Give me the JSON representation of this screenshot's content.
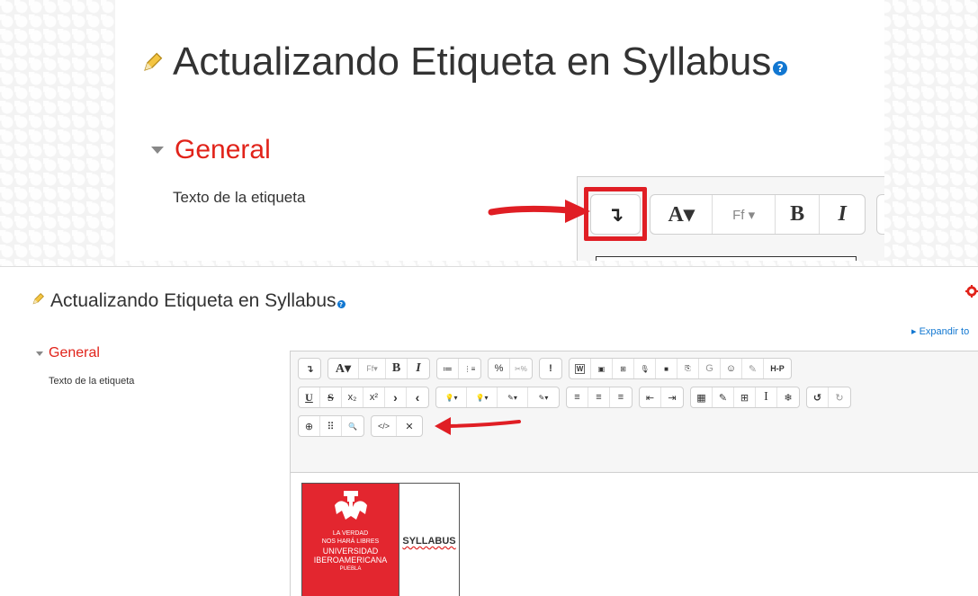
{
  "top_zoom": {
    "title": "Actualizando Etiqueta en Syllabus",
    "section_title": "General",
    "field_label": "Texto de la etiqueta",
    "toolbar_toggle_glyph": "↴",
    "font_color_glyph": "A▾",
    "font_family_glyph": "Ff ▾",
    "bold_glyph": "B",
    "italic_glyph": "I"
  },
  "page": {
    "title": "Actualizando Etiqueta en Syllabus",
    "expand_all_label": "▸ Expandir to",
    "section_title": "General",
    "field_label": "Texto de la etiqueta"
  },
  "toolbar": {
    "row1": {
      "g1": [
        "↴"
      ],
      "g2": [
        "A▾",
        "Ff▾",
        "B",
        "I"
      ],
      "g3": [
        "≔",
        "⋮≡"
      ],
      "g4": [
        "%",
        "✂%"
      ],
      "g5": [
        "!"
      ],
      "g6": [
        "W",
        "▣",
        "⊞",
        "🎙",
        "■",
        "⎘",
        "G",
        "☺",
        "✎",
        "H-P"
      ]
    },
    "row2": {
      "g1": [
        "U",
        "S",
        "x₂",
        "x²",
        "›",
        "‹"
      ],
      "g2": [
        "💡▾",
        "💡▾",
        "✎▾",
        "✎▾"
      ],
      "g3": [
        "≡",
        "≡",
        "≡"
      ],
      "g4": [
        "⇤",
        "⇥"
      ],
      "g5": [
        "▦",
        "✎",
        "⊞",
        "I",
        "❄"
      ],
      "g6": [
        "↺",
        "↻"
      ]
    },
    "row3": {
      "g1": [
        "⊕",
        "⠿",
        "🔍"
      ],
      "g2": [
        "</>",
        "✕"
      ]
    }
  },
  "content": {
    "logo_lines": [
      "LA VERDAD",
      "NOS HARÁ LIBRES",
      "UNIVERSIDAD",
      "IBEROAMERICANA",
      "PUEBLA"
    ],
    "syllabus_text": "SYLLABUS"
  },
  "colors": {
    "accent_red": "#e1231a",
    "link_blue": "#1177d1",
    "logo_red": "#e3262f",
    "highlight_red": "#e01e24"
  }
}
